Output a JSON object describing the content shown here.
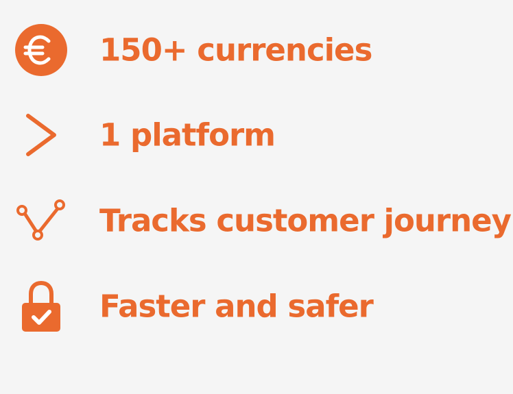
{
  "theme": {
    "accent_color": "#ea6a2e",
    "background_color": "#f5f5f5"
  },
  "features": [
    {
      "icon": "euro-coin-icon",
      "label": "150+ currencies"
    },
    {
      "icon": "chevron-right-icon",
      "label": "1 platform"
    },
    {
      "icon": "route-path-icon",
      "label": "Tracks customer journey"
    },
    {
      "icon": "padlock-check-icon",
      "label": "Faster and safer"
    }
  ]
}
